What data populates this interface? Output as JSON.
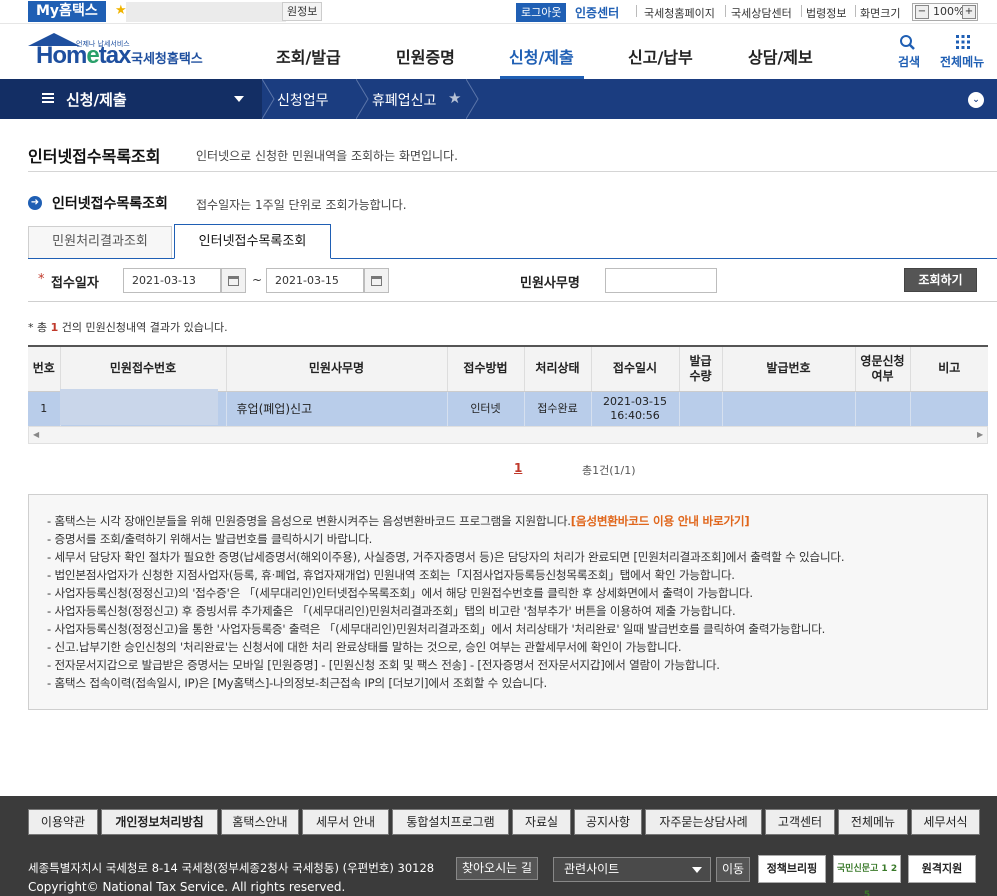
{
  "topbar": {
    "my_label": "My홈택스",
    "info_label": "원정보",
    "logout_label": "로그아웃",
    "cert_label": "인증센터",
    "links": [
      "국세청홈페이지",
      "국세상담센터",
      "법령정보",
      "화면크기"
    ],
    "zoom_minus": "−",
    "zoom_value": "100%",
    "zoom_plus": "+"
  },
  "header": {
    "logo_small": "언제나 납세서비스",
    "logo_main_a": "Hom",
    "logo_main_e": "e",
    "logo_main_b": "tax",
    "logo_kr": "국세청홈택스",
    "menu": [
      "조회/발급",
      "민원증명",
      "신청/제출",
      "신고/납부",
      "상담/제보"
    ],
    "active_menu": "신청/제출",
    "search_label": "검색",
    "all_menu_label": "전체메뉴"
  },
  "navbar": {
    "title": "신청/제출",
    "crumbs": [
      "신청업무",
      "휴폐업신고"
    ],
    "circle": "⌄"
  },
  "page": {
    "title": "인터넷접수목록조회",
    "desc": "인터넷으로 신청한 민원내역을 조회하는 화면입니다.",
    "section_title": "인터넷접수목록조회",
    "section_desc": "접수일자는 1주일 단위로 조회가능합니다.",
    "section_icon": "➜"
  },
  "tabs": [
    "민원처리결과조회",
    "인터넷접수목록조회"
  ],
  "search": {
    "required_mark": "*",
    "date_label": "접수일자",
    "date_from": "2021-03-13",
    "date_to": "2021-03-15",
    "tilde": "~",
    "name_label": "민원사무명",
    "name_value": "",
    "button": "조회하기"
  },
  "result": {
    "prefix": "* 총 ",
    "count": "1",
    "suffix": " 건의 민원신청내역 결과가 있습니다."
  },
  "table": {
    "headers": [
      "번호",
      "민원접수번호",
      "민원사무명",
      "접수방법",
      "처리상태",
      "접수일시",
      "발급\n수량",
      "발급번호",
      "영문신청\n여부",
      "비고"
    ],
    "rows": [
      {
        "no": "1",
        "receipt_no": "",
        "name": "휴업(폐업)신고",
        "method": "인터넷",
        "status": "접수완료",
        "date": "2021-03-15",
        "time": "16:40:56",
        "qty": "",
        "issue_no": "",
        "english": "",
        "remark": ""
      }
    ]
  },
  "pagination": {
    "current": "1",
    "total": "총1건(1/1)"
  },
  "notes": [
    {
      "text": "- 홈택스는 시각 장애인분들을 위해 민원증명을 음성으로 변환시켜주는 음성변환바코드 프로그램을 지원합니다.",
      "highlight": "[음성변환바코드 이용 안내 바로가기]"
    },
    {
      "text": "- 증명서를 조회/출력하기 위해서는 발급번호를 클릭하시기 바랍니다.",
      "highlight": ""
    },
    {
      "text": "- 세무서 담당자 확인 절차가 필요한 증명(납세증명서(해외이주용), 사실증명, 거주자증명서 등)은 담당자의 처리가 완료되면 [민원처리결과조회]에서 출력할 수 있습니다.",
      "highlight": ""
    },
    {
      "text": "- 법인본점사업자가 신청한 지점사업자(등록, 휴·폐업, 휴업자재개업) 민원내역 조회는「지점사업자등록등신청목록조회」탭에서 확인 가능합니다.",
      "highlight": ""
    },
    {
      "text": "- 사업자등록신청(정정신고)의 '접수증'은 「(세무대리인)인터넷접수목록조회」에서 해당 민원접수번호를 클릭한 후 상세화면에서 출력이 가능합니다.",
      "highlight": ""
    },
    {
      "text": "- 사업자등록신청(정정신고) 후 증빙서류 추가제출은 「(세무대리인)민원처리결과조회」탭의 비고란 '첨부추가' 버튼을 이용하여 제출 가능합니다.",
      "highlight": ""
    },
    {
      "text": "- 사업자등록신청(정정신고)을 통한 '사업자등록증' 출력은 「(세무대리인)민원처리결과조회」에서 처리상태가 '처리완료' 일때 발급번호를 클릭하여 출력가능합니다.",
      "highlight": ""
    },
    {
      "text": "- 신고.납부기한 승인신청의 '처리완료'는 신청서에 대한 처리 완료상태를 말하는 것으로, 승인 여부는 관할세무서에 확인이 가능합니다.",
      "highlight": ""
    },
    {
      "text": "- 전자문서지갑으로 발급받은 증명서는 모바일 [민원증명] - [민원신청 조회 및 팩스 전송] - [전자증명서 전자문서지갑]에서 열람이 가능합니다.",
      "highlight": ""
    },
    {
      "text": "- 홈택스 접속이력(접속일시, IP)은 [My홈택스]-나의정보-최근접속 IP의 [더보기]에서 조회할 수 있습니다.",
      "highlight": ""
    }
  ],
  "footer": {
    "links": [
      "이용약관",
      "개인정보처리방침",
      "홈택스안내",
      "세무서 안내",
      "통합설치프로그램",
      "자료실",
      "공지사항",
      "자주묻는상담사례",
      "고객센터",
      "전체메뉴",
      "세무서식"
    ],
    "address": "세종특별자치시 국세청로 8-14 국세청(정부세종2청사 국세청동) (우편번호) 30128",
    "find_label": "찾아오시는 길",
    "related_label": "관련사이트",
    "go_label": "이동",
    "badges": [
      "정책브리핑",
      "국민신문고 1 2 5",
      "원격지원"
    ],
    "copyright": "Copyright© National Tax Service. All rights reserved."
  },
  "colors": {
    "brand": "#1f5fb4",
    "nav": "#1b3d80",
    "highlight": "#e0661b",
    "row_selected": "#b9cdea"
  }
}
